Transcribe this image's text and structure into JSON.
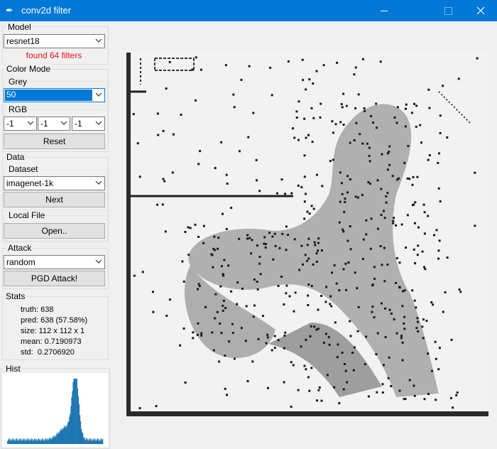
{
  "window": {
    "title": "conv2d filter",
    "icon": "feather-icon",
    "accent": "#0078d7"
  },
  "model": {
    "label": "Model",
    "selected": "resnet18",
    "status": "found 64 filters",
    "status_color": "#e81123"
  },
  "color_mode": {
    "label": "Color Mode",
    "grey": {
      "label": "Grey",
      "selected": "50"
    },
    "rgb": {
      "label": "RGB",
      "values": [
        "-1",
        "-1",
        "-1"
      ]
    },
    "reset_label": "Reset"
  },
  "data": {
    "label": "Data",
    "dataset": {
      "label": "Dataset",
      "selected": "imagenet-1k",
      "next_label": "Next"
    },
    "local_file": {
      "label": "Local File",
      "open_label": "Open.."
    }
  },
  "attack": {
    "label": "Attack",
    "selected": "random",
    "button_label": "PGD Attack!"
  },
  "stats": {
    "label": "Stats",
    "truth": "truth: 638",
    "pred": "pred: 638 (57.58%)",
    "size": "size: 112 x 112 x 1",
    "mean": "mean: 0.7190973",
    "std": "std:  0.2706920"
  },
  "hist": {
    "label": "Hist",
    "bar_color": "#1f77b4"
  },
  "viewer": {
    "content": "filtered-feature-map-image"
  }
}
